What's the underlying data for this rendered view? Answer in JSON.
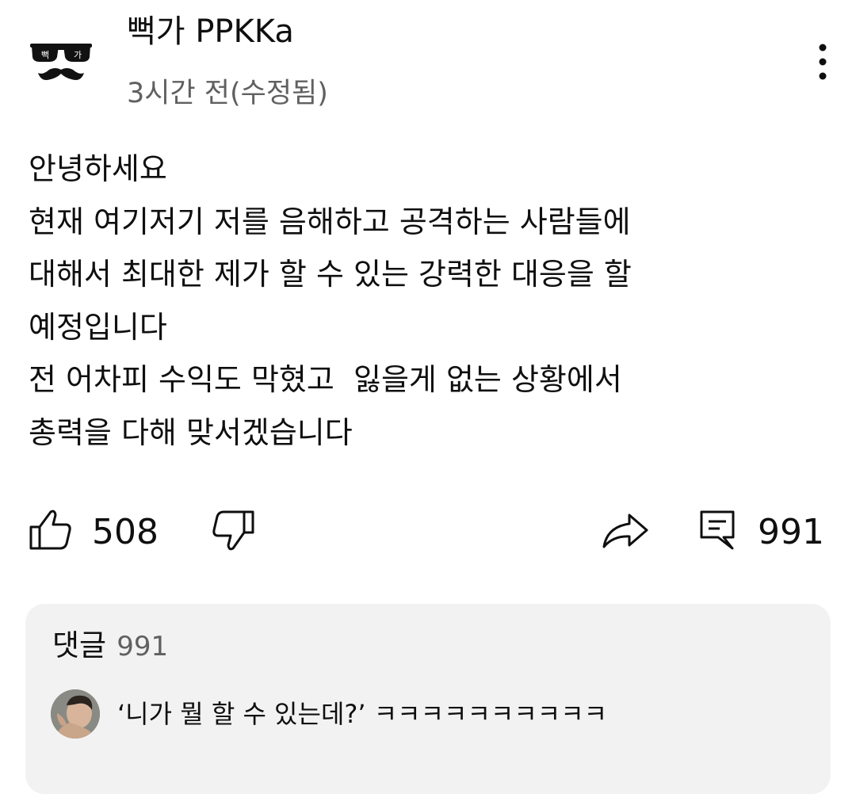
{
  "post": {
    "author": {
      "name": "뻑가 PPKKa",
      "avatar_text_left": "뻑",
      "avatar_text_right": "가"
    },
    "time": "3시간 전(수정됨)",
    "body_lines": [
      "안녕하세요",
      "현재 여기저기 저를 음해하고 공격하는 사람들에",
      "대해서 최대한 제가 할 수 있는 강력한 대응을 할",
      "예정입니다",
      "전 어차피 수익도 막혔고  잃을게 없는 상황에서",
      "총력을 다해 맞서겠습니다"
    ]
  },
  "actions": {
    "like_count": "508",
    "comment_count": "991",
    "icons": {
      "like": "thumb-up-icon",
      "dislike": "thumb-down-icon",
      "share": "share-icon",
      "comment": "comment-icon",
      "more": "more-vert-icon"
    }
  },
  "comments": {
    "title": "댓글",
    "count": "991",
    "top_comment": {
      "text": "‘니가 뭘 할 수 있는데?’ ㅋㅋㅋㅋㅋㅋㅋㅋㅋㅋ"
    }
  },
  "colors": {
    "text_primary": "#0f0f0f",
    "text_secondary": "#606060",
    "panel_background": "#f2f2f2"
  }
}
